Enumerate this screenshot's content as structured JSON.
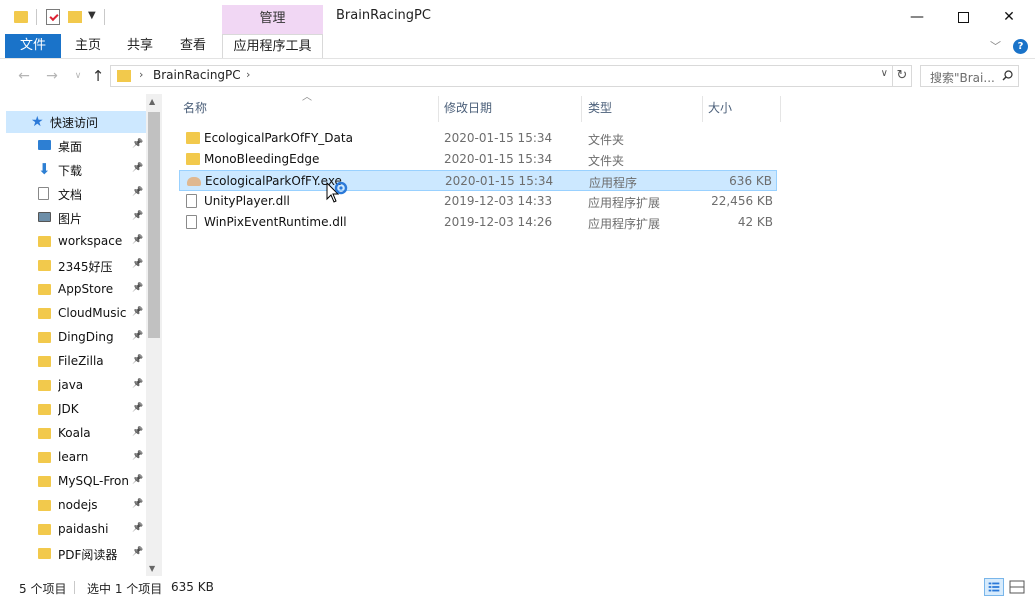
{
  "window": {
    "title": "BrainRacingPC",
    "contextual_tab_group": "管理",
    "minimize": "—",
    "close": "✕"
  },
  "ribbon": {
    "tabs": [
      "文件",
      "主页",
      "共享",
      "查看",
      "应用程序工具"
    ],
    "active_tab": "文件",
    "file_tab_color": "#1a73c9",
    "manage_color": "#f1d7f4"
  },
  "address": {
    "path": "BrainRacingPC",
    "search_placeholder": "搜索\"Brai...",
    "refresh_symbol": "↻"
  },
  "nav": {
    "quick_access": "快速访问",
    "items": [
      {
        "label": "桌面",
        "icon": "desktop-icon"
      },
      {
        "label": "下载",
        "icon": "download-icon"
      },
      {
        "label": "文档",
        "icon": "document-icon"
      },
      {
        "label": "图片",
        "icon": "pictures-icon"
      },
      {
        "label": "workspace",
        "icon": "folder-icon"
      },
      {
        "label": "2345好压",
        "icon": "folder-icon"
      },
      {
        "label": "AppStore",
        "icon": "folder-icon"
      },
      {
        "label": "CloudMusic",
        "icon": "folder-icon"
      },
      {
        "label": "DingDing",
        "icon": "folder-icon"
      },
      {
        "label": "FileZilla",
        "icon": "folder-icon"
      },
      {
        "label": "java",
        "icon": "folder-icon"
      },
      {
        "label": "JDK",
        "icon": "folder-icon"
      },
      {
        "label": "Koala",
        "icon": "folder-icon"
      },
      {
        "label": "learn",
        "icon": "folder-icon"
      },
      {
        "label": "MySQL-Fron",
        "icon": "folder-icon"
      },
      {
        "label": "nodejs",
        "icon": "folder-icon"
      },
      {
        "label": "paidashi",
        "icon": "folder-icon"
      },
      {
        "label": "PDF阅读器",
        "icon": "folder-icon"
      }
    ]
  },
  "columns": {
    "name": "名称",
    "date": "修改日期",
    "type": "类型",
    "size": "大小"
  },
  "files": [
    {
      "name": "EcologicalParkOfFY_Data",
      "date": "2020-01-15 15:34",
      "type": "文件夹",
      "size": "",
      "icon": "folder-icon"
    },
    {
      "name": "MonoBleedingEdge",
      "date": "2020-01-15 15:34",
      "type": "文件夹",
      "size": "",
      "icon": "folder-icon"
    },
    {
      "name": "EcologicalParkOfFY.exe",
      "date": "2020-01-15 15:34",
      "type": "应用程序",
      "size": "636 KB",
      "icon": "application-icon",
      "selected": true
    },
    {
      "name": "UnityPlayer.dll",
      "date": "2019-12-03 14:33",
      "type": "应用程序扩展",
      "size": "22,456 KB",
      "icon": "dll-file-icon"
    },
    {
      "name": "WinPixEventRuntime.dll",
      "date": "2019-12-03 14:26",
      "type": "应用程序扩展",
      "size": "42 KB",
      "icon": "dll-file-icon"
    }
  ],
  "status": {
    "count": "5 个项目",
    "selected": "选中 1 个项目",
    "selected_size": "635 KB"
  }
}
